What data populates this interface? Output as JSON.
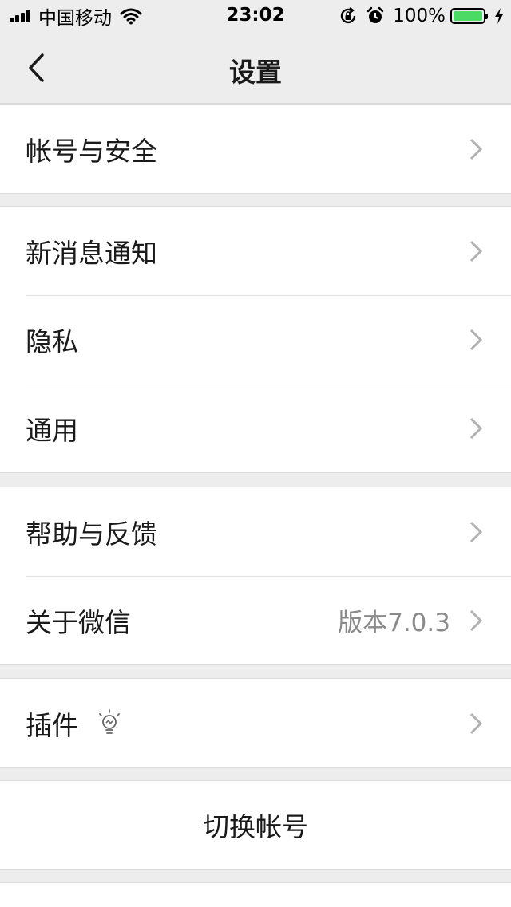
{
  "status_bar": {
    "carrier": "中国移动",
    "time": "23:02",
    "battery": "100%"
  },
  "nav": {
    "title": "设置"
  },
  "groups": [
    {
      "items": [
        {
          "label": "帐号与安全"
        }
      ]
    },
    {
      "items": [
        {
          "label": "新消息通知"
        },
        {
          "label": "隐私"
        },
        {
          "label": "通用"
        }
      ]
    },
    {
      "items": [
        {
          "label": "帮助与反馈"
        },
        {
          "label": "关于微信",
          "value": "版本7.0.3"
        }
      ]
    },
    {
      "items": [
        {
          "label": "插件"
        }
      ]
    }
  ],
  "switch_account": {
    "label": "切换帐号"
  },
  "colors": {
    "background": "#ededed",
    "cell": "#ffffff",
    "battery_fill": "#4cd964",
    "secondary_text": "#8a8a8a"
  }
}
